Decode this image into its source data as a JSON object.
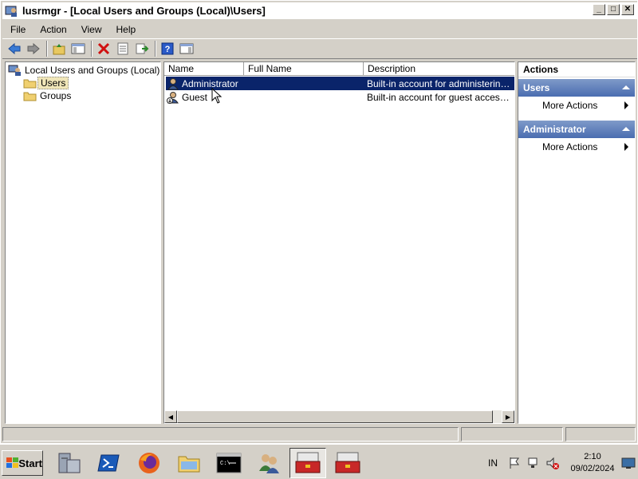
{
  "window": {
    "title": "lusrmgr - [Local Users and Groups (Local)\\Users]"
  },
  "menu": [
    "File",
    "Action",
    "View",
    "Help"
  ],
  "toolbar": [
    "back-icon",
    "forward-icon",
    "up-folder-icon",
    "show-hide-tree-icon",
    "delete-icon",
    "properties-icon",
    "export-list-icon",
    "help-icon",
    "show-hide-action-pane-icon"
  ],
  "tree": {
    "root": "Local Users and Groups (Local)",
    "items": [
      {
        "label": "Users",
        "selected": true
      },
      {
        "label": "Groups",
        "selected": false
      }
    ]
  },
  "list": {
    "columns": [
      "Name",
      "Full Name",
      "Description"
    ],
    "rows": [
      {
        "name": "Administrator",
        "full_name": "",
        "description": "Built-in account for administering the...",
        "selected": true
      },
      {
        "name": "Guest",
        "full_name": "",
        "description": "Built-in account for guest access to t...",
        "selected": false
      }
    ]
  },
  "actions": {
    "title": "Actions",
    "groups": [
      {
        "header": "Users",
        "items": [
          "More Actions"
        ]
      },
      {
        "header": "Administrator",
        "items": [
          "More Actions"
        ]
      }
    ]
  },
  "taskbar": {
    "start_label": "Start",
    "apps": [
      "server-manager-icon",
      "powershell-icon",
      "firefox-icon",
      "explorer-icon",
      "cmd-icon",
      "users-groups-icon",
      "toolbox-icon",
      "toolbox-icon"
    ],
    "language": "IN",
    "clock": {
      "time": "2:10",
      "date": "09/02/2024"
    }
  }
}
